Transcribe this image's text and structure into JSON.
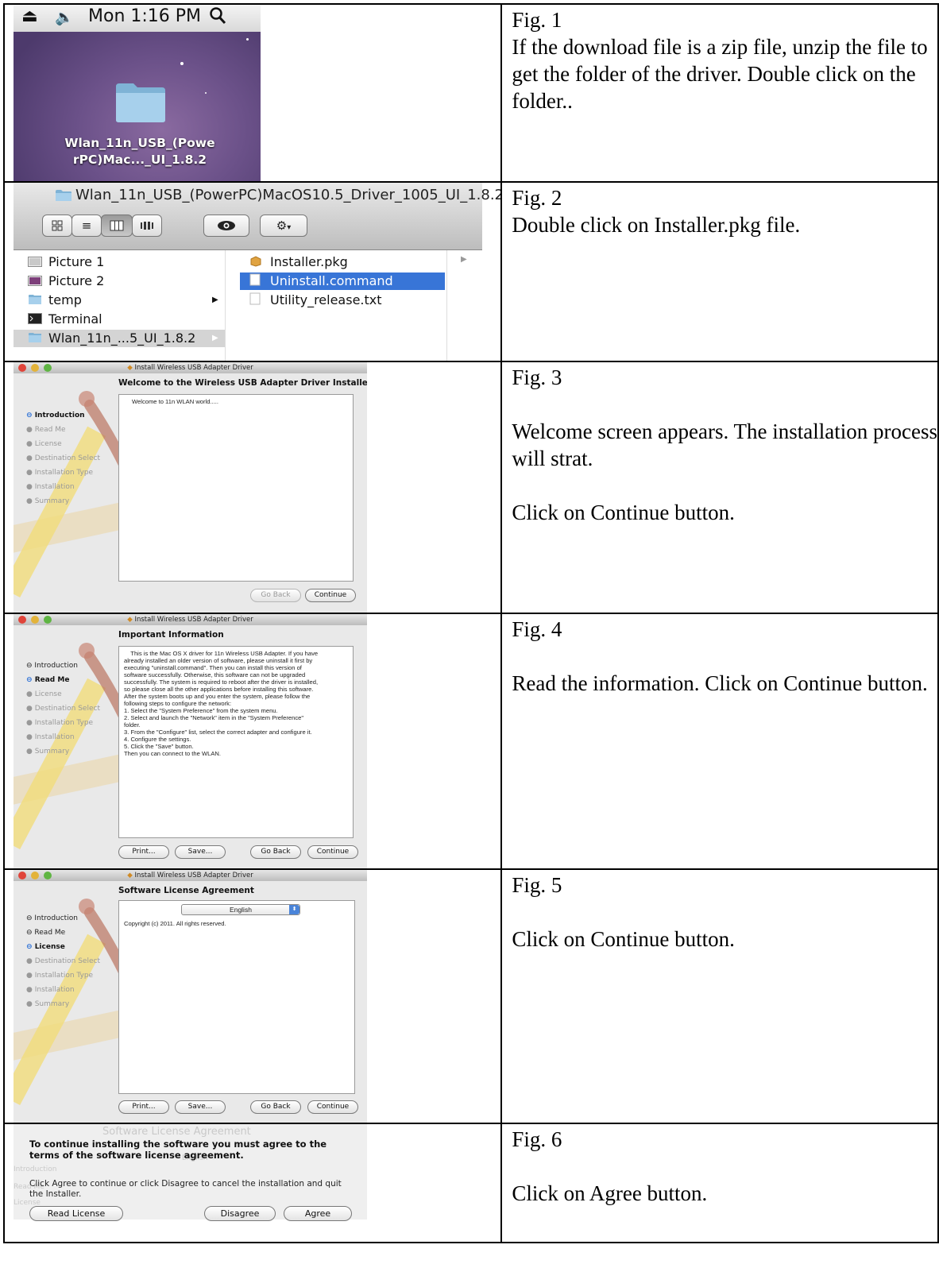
{
  "figures": [
    {
      "label": "Fig. 1",
      "paragraphs": [
        "If the download file is a zip file, unzip the file to get the folder of the driver. Double click on the folder.."
      ]
    },
    {
      "label": "Fig. 2",
      "paragraphs": [
        "Double click on Installer.pkg file."
      ]
    },
    {
      "label": "Fig. 3",
      "paragraphs": [
        "Welcome screen appears.  The installation process will strat.",
        "Click on Continue button."
      ]
    },
    {
      "label": "Fig. 4",
      "paragraphs": [
        "Read the information.  Click on Continue button."
      ]
    },
    {
      "label": "Fig. 5",
      "paragraphs": [
        "Click on Continue button."
      ]
    },
    {
      "label": "Fig. 6",
      "paragraphs": [
        "Click on Agree button."
      ]
    }
  ],
  "desktop": {
    "clock": "Mon 1:16 PM",
    "folder_label_line1": "Wlan_11n_USB_(Powe",
    "folder_label_line2": "rPC)Mac..._UI_1.8.2"
  },
  "finder": {
    "title": "Wlan_11n_USB_(PowerPC)MacOS10.5_Driver_1005_UI_1.8.2",
    "left_items": [
      "Picture 1",
      "Picture 2",
      "temp",
      "Terminal",
      "Wlan_11n_...5_UI_1.8.2"
    ],
    "right_items": [
      "Installer.pkg",
      "Uninstall.command",
      "Utility_release.txt"
    ]
  },
  "installer": {
    "window_title": "Install Wireless USB Adapter Driver",
    "steps": [
      "Introduction",
      "Read Me",
      "License",
      "Destination Select",
      "Installation Type",
      "Installation",
      "Summary"
    ],
    "welcome_heading": "Welcome to the Wireless USB Adapter Driver Installer",
    "welcome_text": "Welcome to 11n WLAN world.....",
    "info_heading": "Important Information",
    "info_lines": [
      "    This is the Mac OS X driver for 11n Wireless USB Adapter. If you have",
      "already installed an older version of software, please uninstall it first by",
      "executing \"uninstall.command\". Then you can install this version of",
      "software successfully. Otherwise, this software can not be upgraded",
      "successfully. The system is required to reboot after the driver is installed,",
      "so please close all the other applications before installing this software.",
      "After the system boots up and you enter the system, please follow the",
      "following steps to configure the network:",
      "1. Select the \"System Preference\" from the system menu.",
      "2. Select and launch the \"Network\" item in the \"System Preference\"",
      "folder.",
      "3. From the \"Configure\" list, select the correct adapter and configure it.",
      "4. Configure the settings.",
      "5. Click the \"Save\" button.",
      "Then you can connect to the WLAN."
    ],
    "license_heading": "Software License Agreement",
    "license_language": "English",
    "license_text": "Copyright (c) 2011.  All rights reserved.",
    "btn_print": "Print...",
    "btn_save": "Save...",
    "btn_goback": "Go Back",
    "btn_continue": "Continue"
  },
  "sheet": {
    "message1": "To continue installing the software you must agree to the terms of the software license agreement.",
    "message2": "Click Agree to continue or click Disagree to cancel the installation and quit the Installer.",
    "btn_read_license": "Read License",
    "btn_disagree": "Disagree",
    "btn_agree": "Agree",
    "ghost_heading": "Software License Agreement",
    "ghost_language": "English",
    "ghost_step1": "Introduction",
    "ghost_step2": "Read Me",
    "ghost_step3": "License"
  }
}
